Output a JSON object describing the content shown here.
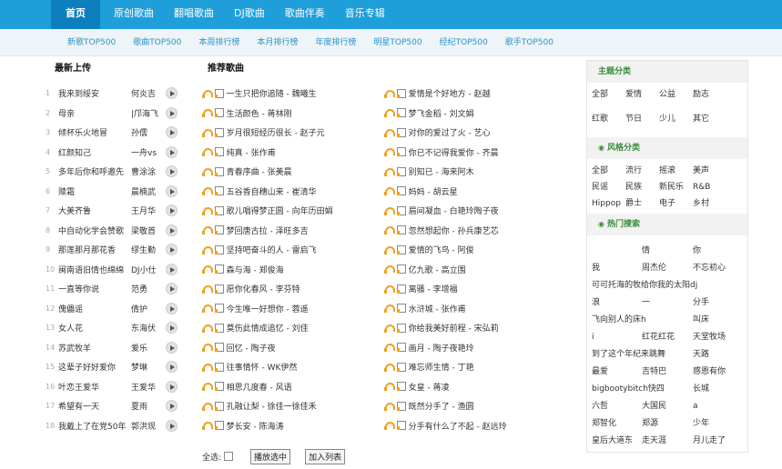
{
  "topnav": {
    "items": [
      "首页",
      "原创歌曲",
      "翻唱歌曲",
      "DJ歌曲",
      "歌曲伴奏",
      "音乐专辑"
    ]
  },
  "subnav": {
    "items": [
      "新歌TOP500",
      "歌曲TOP500",
      "本周排行榜",
      "本月排行榜",
      "年度排行榜",
      "明星TOP500",
      "经纪TOP500",
      "歌手TOP500"
    ]
  },
  "latest": {
    "title": "最新上传",
    "rows": [
      {
        "num": "1",
        "song": "我来到绥安",
        "artist": "何炎吉"
      },
      {
        "num": "2",
        "song": "母亲",
        "artist": "|邝海飞"
      },
      {
        "num": "3",
        "song": "倾杯乐火地冒",
        "artist": "孙儒"
      },
      {
        "num": "4",
        "song": "红颜知己",
        "artist": "一舟vs"
      },
      {
        "num": "5",
        "song": "多年后你和呼邀先",
        "artist": "曹涂涂"
      },
      {
        "num": "6",
        "song": "赎霜",
        "artist": "晨楠武"
      },
      {
        "num": "7",
        "song": "大美齐鲁",
        "artist": "王月华"
      },
      {
        "num": "8",
        "song": "中自动化学会赞歌",
        "artist": "梁敬首"
      },
      {
        "num": "9",
        "song": "那莲那月那花香",
        "artist": "缪生勤"
      },
      {
        "num": "10",
        "song": "闽南语旧情也绵绵",
        "artist": "DJ小仕"
      },
      {
        "num": "11",
        "song": "一直等你说",
        "artist": "范勇"
      },
      {
        "num": "12",
        "song": "傀儡谣",
        "artist": "倩护"
      },
      {
        "num": "13",
        "song": "女人花",
        "artist": "东海伏"
      },
      {
        "num": "14",
        "song": "苏武牧羊",
        "artist": "爱乐"
      },
      {
        "num": "15",
        "song": "这辈子好好爱你",
        "artist": "梦琳"
      },
      {
        "num": "16",
        "song": "叶恋王爱华",
        "artist": "王爱华"
      },
      {
        "num": "17",
        "song": "希望有一天",
        "artist": "夏雨"
      },
      {
        "num": "18",
        "song": "我戴上了在党50年",
        "artist": "郭洪现"
      }
    ]
  },
  "recommend": {
    "title": "推荐歌曲",
    "left": [
      "一生只把你追随 - 魏曦生",
      "生活颜色 - 蒋林刚",
      "岁月很短经历很长 - 赵子元",
      "纯真 - 张作甫",
      "青春序曲 - 张美晨",
      "五谷香自穗山来 - 崔清华",
      "歌儿唱得梦正圆 - 向年历田娟",
      "梦回唐古拉 - 泽旺多吉",
      "坚持吧奋斗的人 - 雷启飞",
      "森与海 - 郑俊海",
      "愿你化春风 - 李芬特",
      "今生唯一好想你 - 蓉遥",
      "莫伤此情成追忆 - 刘佳",
      "回忆 - 陶子夜",
      "往事情怀 - WK伊然",
      "相思几度春 - 风语",
      "孔融让梨 - 徐佳一徐佳禾",
      "梦长安 - 陈海涛"
    ],
    "right": [
      "爱情是个好地方 - 赵越",
      "梦飞金稻 - 刘文娟",
      "对你的爱过了火 - 艺心",
      "你已不记得我爱你 - 齐晨",
      "别知已 - 海来阿木",
      "妈妈 - 胡云星",
      "眉间凝血 - 白艳玲陶子夜",
      "忽然想起你 - 孙兵康艺芯",
      "爱情的飞鸟 - 阿俊",
      "亿九歌 - 高立围",
      "离骚 - 李增福",
      "水浒城 - 张作甫",
      "你给我美好前程 - 宋弘莉",
      "画月 - 陶子夜艳玲",
      "难忘师生情 - 丁艳",
      "女皇 - 蒋凌",
      "既然分手了 - 渔圆",
      "分手有什么了不起 - 赵远玲"
    ]
  },
  "controls": {
    "select_all_label": "全选:",
    "play_selected": "播放选中",
    "add_to_list": "加入列表"
  },
  "sidebar": {
    "theme_title": "主题分类",
    "theme_tags": [
      "全部",
      "爱情",
      "公益",
      "励志",
      "红歌",
      "节日",
      "少儿",
      "其它"
    ],
    "style_title": "风格分类",
    "style_tags": [
      "全部",
      "流行",
      "摇滚",
      "美声",
      "民谣",
      "民族",
      "新民乐",
      "R&B",
      "Hippop",
      "爵士",
      "电子",
      "乡村"
    ],
    "hot_title": "热门搜索",
    "hot_rows": [
      [
        "",
        "情",
        "你"
      ],
      [
        "我",
        "周杰伦",
        "不忘初心"
      ],
      [
        "可可托海的牧给你我的太阳dj",
        "",
        ""
      ],
      [
        "浪",
        "一",
        "分手"
      ],
      [
        "飞向别人的床h",
        "",
        "叫床"
      ],
      [
        "i",
        "红花红花",
        "天堂牧场"
      ],
      [
        "到了这个年纪来跳舞",
        "",
        "天路"
      ],
      [
        "最爱",
        "吉特巴",
        "感恩有你"
      ],
      [
        "bigbootybitch快四",
        "",
        "长城"
      ],
      [
        "六哲",
        "大国民",
        "a"
      ],
      [
        "郑智化",
        "郑源",
        "少年"
      ],
      [
        "皇后大道东",
        "走天涯",
        "月儿走了"
      ]
    ]
  }
}
